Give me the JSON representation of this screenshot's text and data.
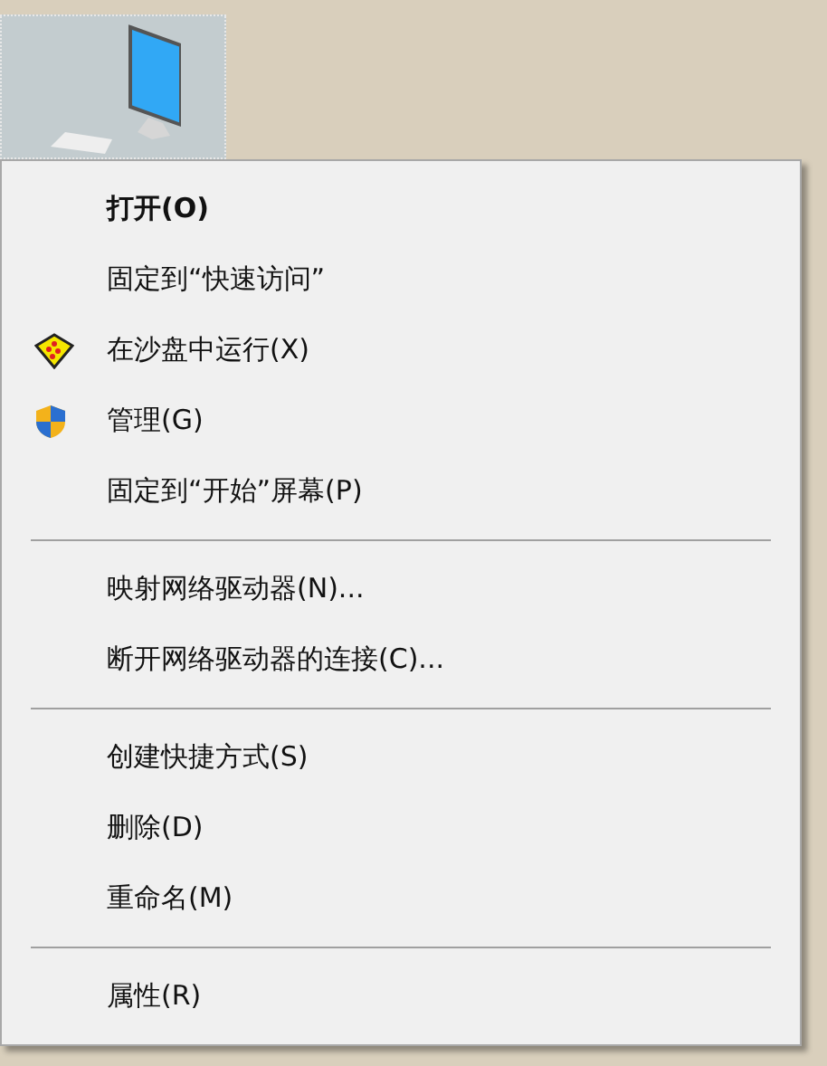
{
  "desktop_icon": {
    "selected": true
  },
  "menu": {
    "groups": [
      [
        {
          "label": "打开(O)",
          "default": true
        },
        {
          "label": "固定到“快速访问”",
          "default": false
        },
        {
          "label": "在沙盘中运行(X)",
          "default": false,
          "kind": "sandbox"
        },
        {
          "label": "管理(G)",
          "default": false,
          "kind": "shield"
        },
        {
          "label": "固定到“开始”屏幕(P)",
          "default": false
        }
      ],
      [
        {
          "label": "映射网络驱动器(N)...",
          "default": false
        },
        {
          "label": "断开网络驱动器的连接(C)...",
          "default": false
        }
      ],
      [
        {
          "label": "创建快捷方式(S)",
          "default": false
        },
        {
          "label": "删除(D)",
          "default": false
        },
        {
          "label": "重命名(M)",
          "default": false
        }
      ],
      [
        {
          "label": "属性(R)",
          "default": false
        }
      ]
    ]
  }
}
